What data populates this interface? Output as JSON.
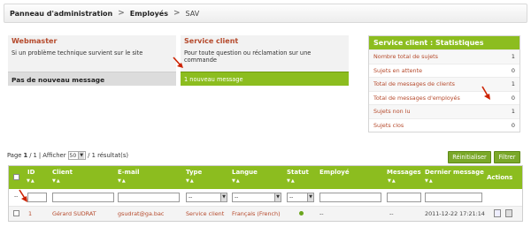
{
  "breadcrumb": {
    "items": [
      "Panneau d'administration",
      "Employés",
      "SAV"
    ],
    "separator": ">"
  },
  "panels": {
    "webmaster": {
      "title": "Webmaster",
      "description": "Si un problème technique survient sur le site",
      "status": "Pas de nouveau message"
    },
    "service_client": {
      "title": "Service client",
      "description": "Pour toute question ou réclamation sur une commande",
      "status": "1 nouveau message"
    }
  },
  "stats": {
    "title": "Service client : Statistiques",
    "rows": [
      {
        "label": "Nombre total de sujets",
        "value": "1"
      },
      {
        "label": "Sujets en attente",
        "value": "0"
      },
      {
        "label": "Total de messages de clients",
        "value": "1"
      },
      {
        "label": "Total de messages d'employés",
        "value": "0"
      },
      {
        "label": "Sujets non lu",
        "value": "1"
      },
      {
        "label": "Sujets clos",
        "value": "0"
      }
    ]
  },
  "pagination": {
    "page_label": "Page",
    "current": "1",
    "sep": "/",
    "total": "1",
    "show_label": "| Afficher",
    "per_page": "50",
    "results": "/ 1 résultat(s)"
  },
  "buttons": {
    "reset": "Réinitialiser",
    "filter": "Filtrer"
  },
  "table": {
    "columns": [
      "ID",
      "Client",
      "E-mail",
      "Type",
      "Langue",
      "Statut",
      "Employé",
      "Messages",
      "Dernier message",
      "Actions"
    ],
    "filter_select_value": "--",
    "row": {
      "id": "1",
      "client": "Gérard SUDRAT",
      "email": "gsudrat@ga.bac",
      "type": "Service client",
      "langue": "Français (French)",
      "employe": "--",
      "messages": "--",
      "dernier_message": "2011-12-22 17:21:14"
    }
  },
  "colors": {
    "accent_green": "#8cbd1f",
    "title_red": "#b5492b",
    "annotation_arrow": "#cc2200"
  }
}
